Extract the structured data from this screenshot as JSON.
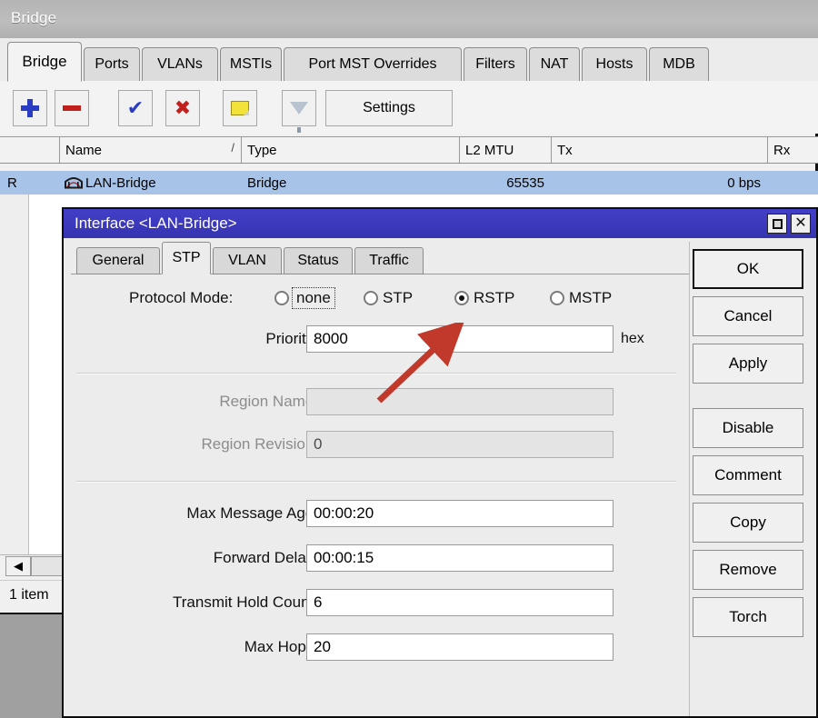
{
  "window": {
    "title": "Bridge",
    "tabs": [
      {
        "label": "Bridge",
        "active": true
      },
      {
        "label": "Ports",
        "active": false
      },
      {
        "label": "VLANs",
        "active": false
      },
      {
        "label": "MSTIs",
        "active": false
      },
      {
        "label": "Port MST Overrides",
        "active": false
      },
      {
        "label": "Filters",
        "active": false
      },
      {
        "label": "NAT",
        "active": false
      },
      {
        "label": "Hosts",
        "active": false
      },
      {
        "label": "MDB",
        "active": false
      }
    ],
    "toolbar": {
      "add_icon": "plus-icon",
      "remove_icon": "minus-icon",
      "enable_icon": "check-icon",
      "disable_icon": "cross-icon",
      "comment_icon": "note-icon",
      "filter_icon": "funnel-icon",
      "settings_label": "Settings"
    },
    "table": {
      "columns": [
        "",
        "Name",
        "Type",
        "L2 MTU",
        "Tx",
        "Rx"
      ],
      "sort_indicator": "/",
      "rows": [
        {
          "flags": "R",
          "icon": "bridge-icon",
          "name": "LAN-Bridge",
          "type": "Bridge",
          "l2mtu": "65535",
          "tx": "0 bps",
          "rx": ""
        }
      ]
    },
    "scrollbar": {
      "left_arrow": "◀"
    },
    "status": "1 item"
  },
  "dialog": {
    "title": "Interface <LAN-Bridge>",
    "titlebar_controls": {
      "restore": "restore-icon",
      "close": "close-icon"
    },
    "tabs": [
      {
        "label": "General",
        "active": false
      },
      {
        "label": "STP",
        "active": true
      },
      {
        "label": "VLAN",
        "active": false
      },
      {
        "label": "Status",
        "active": false
      },
      {
        "label": "Traffic",
        "active": false
      }
    ],
    "protocol_mode": {
      "label": "Protocol Mode:",
      "options": [
        {
          "label": "none",
          "selected": false,
          "focused": true
        },
        {
          "label": "STP",
          "selected": false,
          "focused": false
        },
        {
          "label": "RSTP",
          "selected": true,
          "focused": false
        },
        {
          "label": "MSTP",
          "selected": false,
          "focused": false
        }
      ]
    },
    "fields": [
      {
        "label": "Priority:",
        "value": "8000",
        "suffix": "hex",
        "disabled": false
      },
      {
        "label": "Region Name:",
        "value": "",
        "suffix": "",
        "disabled": true
      },
      {
        "label": "Region Revision:",
        "value": "0",
        "suffix": "",
        "disabled": true
      },
      {
        "label": "Max Message Age:",
        "value": "00:00:20",
        "suffix": "",
        "disabled": false
      },
      {
        "label": "Forward Delay:",
        "value": "00:00:15",
        "suffix": "",
        "disabled": false
      },
      {
        "label": "Transmit Hold Count:",
        "value": "6",
        "suffix": "",
        "disabled": false
      },
      {
        "label": "Max Hops:",
        "value": "20",
        "suffix": "",
        "disabled": false
      }
    ],
    "buttons": [
      {
        "label": "OK",
        "default": true
      },
      {
        "label": "Cancel",
        "default": false
      },
      {
        "label": "Apply",
        "default": false
      },
      {
        "label": "Disable",
        "default": false
      },
      {
        "label": "Comment",
        "default": false
      },
      {
        "label": "Copy",
        "default": false
      },
      {
        "label": "Remove",
        "default": false
      },
      {
        "label": "Torch",
        "default": false
      }
    ]
  },
  "annotation": {
    "type": "arrow",
    "color": "#c0392b",
    "points_to": "RSTP"
  },
  "colors": {
    "dialog_titlebar": "#3c39bd",
    "row_selected": "#a8c3e8",
    "accent_blue": "#2a3cc4",
    "accent_red": "#c2201c",
    "annotation_red": "#c0392b"
  }
}
